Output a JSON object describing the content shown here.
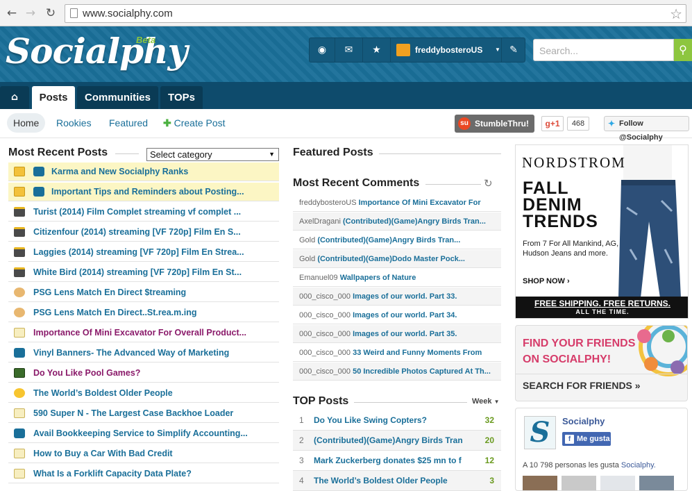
{
  "browser": {
    "url": "www.socialphy.com"
  },
  "header": {
    "logo": "Socialphy",
    "beta": "Beta",
    "username": "freddybosteroUS",
    "search_placeholder": "Search..."
  },
  "mainnav": {
    "tabs": [
      "Posts",
      "Communities",
      "TOPs"
    ]
  },
  "subnav": {
    "home": "Home",
    "rookies": "Rookies",
    "featured": "Featured",
    "create_post": "Create Post",
    "stumble": "StumbleThru!",
    "gplus": "g+1",
    "gplus_count": "468",
    "twitter": "Follow @Socialphy"
  },
  "recent_posts": {
    "title": "Most Recent Posts",
    "category_select": "Select category",
    "items": [
      {
        "text": "Karma and New Socialphy Ranks",
        "color": "#1a6f99",
        "icon": "folder-icon"
      },
      {
        "text": "Important Tips and Reminders about Posting...",
        "color": "#1a6f99",
        "icon": "folder-icon"
      },
      {
        "text": "Turist (2014) Film Complet streaming vf complet ...",
        "color": "#1a6f99",
        "icon": "film-icon"
      },
      {
        "text": "Citizenfour (2014) streaming [VF 720p] Film En S...",
        "color": "#1a6f99",
        "icon": "film-icon"
      },
      {
        "text": "Laggies (2014) streaming [VF 720p] Film En Strea...",
        "color": "#1a6f99",
        "icon": "film-icon"
      },
      {
        "text": "White Bird (2014) streaming [VF 720p] Film En St...",
        "color": "#1a6f99",
        "icon": "film-icon"
      },
      {
        "text": "PSG Lens Match En Direct $treaming",
        "color": "#1a6f99",
        "icon": "palette-icon"
      },
      {
        "text": "PSG Lens Match En Direct..St.rea.m.ing",
        "color": "#1a6f99",
        "icon": "palette-icon"
      },
      {
        "text": "Importance Of Mini Excavator For Overall Product...",
        "color": "#8a1a6a",
        "icon": "pencil-icon"
      },
      {
        "text": "Vinyl Banners- The Advanced Way of Marketing",
        "color": "#1a6f99",
        "icon": "socialphy-icon"
      },
      {
        "text": "Do You Like Pool Games?",
        "color": "#8a1a6a",
        "icon": "game-icon"
      },
      {
        "text": "The World’s Boldest Older People",
        "color": "#1a6f99",
        "icon": "smiley-icon"
      },
      {
        "text": "590 Super N - The Largest Case Backhoe Loader",
        "color": "#1a6f99",
        "icon": "pencil-icon"
      },
      {
        "text": "Avail Bookkeeping Service to Simplify Accounting...",
        "color": "#1a6f99",
        "icon": "socialphy-icon"
      },
      {
        "text": "How to Buy a Car With Bad Credit",
        "color": "#1a6f99",
        "icon": "pencil-icon"
      },
      {
        "text": "What Is a Forklift Capacity Data Plate?",
        "color": "#1a6f99",
        "icon": "pencil-icon"
      }
    ]
  },
  "featured": {
    "title": "Featured Posts"
  },
  "comments": {
    "title": "Most Recent Comments",
    "items": [
      {
        "user": "freddybosteroUS",
        "title": "Importance Of Mini Excavator For"
      },
      {
        "user": "AxelDragani",
        "title": "(Contributed)(Game)Angry Birds Tran..."
      },
      {
        "user": "Gold",
        "title": "(Contributed)(Game)Angry Birds Tran..."
      },
      {
        "user": "Gold",
        "title": "(Contributed)(Game)Dodo Master Pock..."
      },
      {
        "user": "Emanuel09",
        "title": "Wallpapers of Nature"
      },
      {
        "user": "000_cisco_000",
        "title": "Images of our world. Part 33."
      },
      {
        "user": "000_cisco_000",
        "title": "Images of our world. Part 34."
      },
      {
        "user": "000_cisco_000",
        "title": "Images of our world. Part 35."
      },
      {
        "user": "000_cisco_000",
        "title": "33 Weird and Funny Moments From"
      },
      {
        "user": "000_cisco_000",
        "title": "50 Incredible Photos Captured At Th..."
      }
    ]
  },
  "top_posts": {
    "title": "TOP Posts",
    "period": "Week",
    "items": [
      {
        "rank": "1",
        "title": "Do You Like Swing Copters?",
        "count": "32"
      },
      {
        "rank": "2",
        "title": "(Contributed)(Game)Angry Birds Tran",
        "count": "20"
      },
      {
        "rank": "3",
        "title": "Mark Zuckerberg donates $25 mn to f",
        "count": "12"
      },
      {
        "rank": "4",
        "title": "The World’s Boldest Older People",
        "count": "3"
      }
    ]
  },
  "ad": {
    "brand": "NORDSTROM",
    "headline_1": "FALL",
    "headline_2": "DENIM",
    "headline_3": "TRENDS",
    "sub": "From 7 For All Mankind, AG, Hudson Jeans and more.",
    "shop": "SHOP NOW ›",
    "foot_1": "FREE SHIPPING. FREE RETURNS.",
    "foot_2": "ALL THE TIME."
  },
  "find_friends": {
    "line1": "FIND YOUR FRIENDS",
    "line2": "ON SOCIALPHY!",
    "link": "SEARCH FOR FRIENDS »"
  },
  "facebook": {
    "name": "Socialphy",
    "like": "Me gusta",
    "stat_prefix": "A 10 798 personas les gusta",
    "stat_name": "Socialphy."
  }
}
